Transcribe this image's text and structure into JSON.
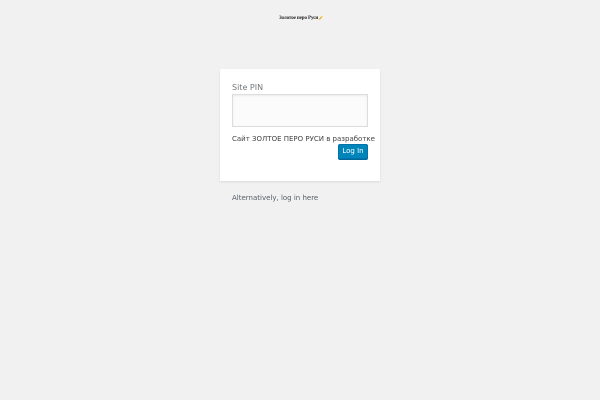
{
  "logo": {
    "text": "Золотое перо Руси",
    "icon": "quill-icon"
  },
  "form": {
    "pin_label": "Site PIN",
    "pin_value": "",
    "notice": "Сайт ЗОЛТОЕ ПЕРО РУСИ в разработке",
    "submit_label": "Log In"
  },
  "footer": {
    "alt_link": "Alternatively, log in here"
  },
  "colors": {
    "background": "#f1f1f1",
    "card": "#ffffff",
    "button": "#0085ba",
    "button_text": "#ffffff",
    "label_text": "#72777c",
    "link_text": "#555d66"
  }
}
